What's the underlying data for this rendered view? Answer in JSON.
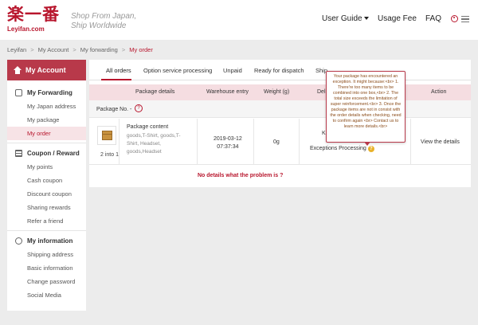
{
  "header": {
    "logo_mark": "楽一番",
    "logo_sub": "Leyifan.com",
    "slogan_line1": "Shop From Japan,",
    "slogan_line2": "Ship Worldwide",
    "nav_user_guide": "User Guide",
    "nav_usage_fee": "Usage Fee",
    "nav_faq": "FAQ"
  },
  "breadcrumb": {
    "items": [
      "Leyifan",
      "My Account",
      "My forwarding",
      "My order"
    ],
    "separator": ">"
  },
  "sidebar": {
    "title": "My Account",
    "sections": [
      {
        "title": "My Forwarding",
        "items": [
          "My Japan address",
          "My package",
          "My order"
        ]
      },
      {
        "title": "Coupon / Reward",
        "items": [
          "My points",
          "Cash coupon",
          "Discount coupon",
          "Sharing rewards",
          "Refer a friend"
        ]
      },
      {
        "title": "My information",
        "items": [
          "Shipping address",
          "Basic information",
          "Change password",
          "Social Media"
        ]
      }
    ],
    "active_item": "My order"
  },
  "tabs": [
    "All orders",
    "Option service processing",
    "Unpaid",
    "Ready for dispatch",
    "Ship"
  ],
  "table": {
    "headers": [
      "Package details",
      "Warehouse entry",
      "Weight (g)",
      "Deli",
      "Action"
    ],
    "package_no_label": "Package No.  -",
    "package_badge": "?",
    "row": {
      "count_label": "2 into 1",
      "content_title": "Package content",
      "content_desc": "goods,T-Shirt, goods,T-Shirt, Headset, goods,Headset",
      "entry_date": "2019-03-12",
      "entry_time": "07:37:34",
      "weight": "0g",
      "status_top": "K",
      "status": "Exceptions Processing",
      "action": "View the details"
    }
  },
  "no_details_link": "No details what the problem is ?",
  "tooltip": {
    "text": "Your package has encountered an exception. It might because:<br> 1. There're too many items to be combined into one box,<br> 2. The total size exceeds the limitation of super reinforcement.<br> 3. Once the package items are not in consist with the order details when checking, need to confirm again <br> Contact us to learn more details.<br>"
  },
  "colors": {
    "brand_red": "#b8162d",
    "sidebar_active_bg": "#f7e3e6",
    "table_header_bg": "#f5dde1"
  },
  "icons": {
    "user": "user-icon",
    "menu": "menu-icon",
    "home": "home-icon",
    "question": "question-icon"
  }
}
